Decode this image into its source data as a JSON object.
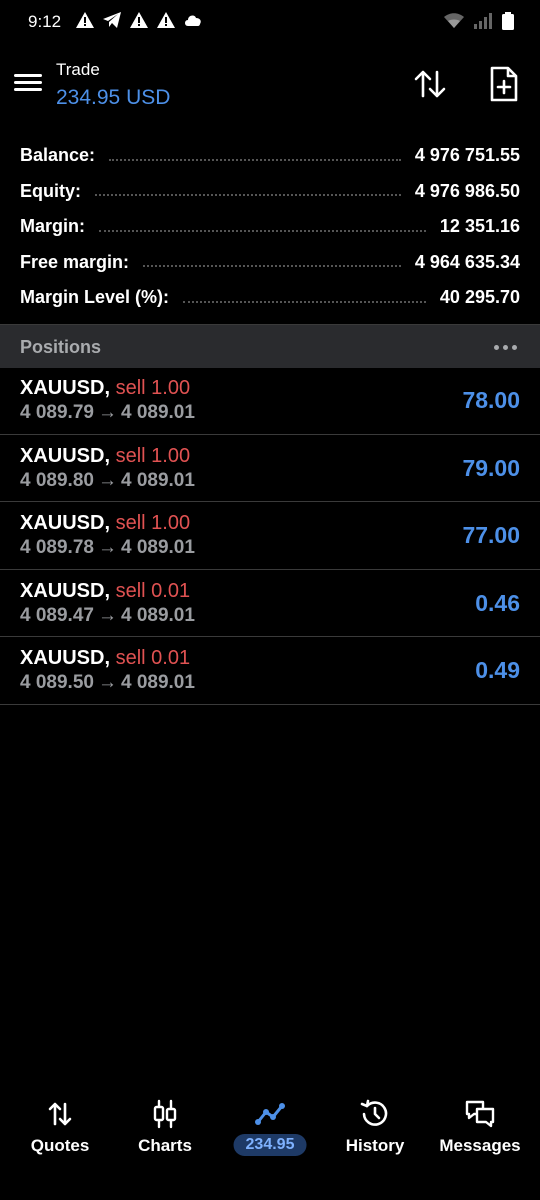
{
  "status_bar": {
    "time": "9:12"
  },
  "header": {
    "title": "Trade",
    "subtitle": "234.95 USD"
  },
  "summary": [
    {
      "label": "Balance:",
      "value": "4 976 751.55"
    },
    {
      "label": "Equity:",
      "value": "4 976 986.50"
    },
    {
      "label": "Margin:",
      "value": "12 351.16"
    },
    {
      "label": "Free margin:",
      "value": "4 964 635.34"
    },
    {
      "label": "Margin Level (%):",
      "value": "40 295.70"
    }
  ],
  "positions_header": {
    "label": "Positions"
  },
  "positions": [
    {
      "symbol": "XAUUSD,",
      "side": "sell 1.00",
      "open": "4 089.79",
      "arrow": "→",
      "current": "4 089.01",
      "profit": "78.00"
    },
    {
      "symbol": "XAUUSD,",
      "side": "sell 1.00",
      "open": "4 089.80",
      "arrow": "→",
      "current": "4 089.01",
      "profit": "79.00"
    },
    {
      "symbol": "XAUUSD,",
      "side": "sell 1.00",
      "open": "4 089.78",
      "arrow": "→",
      "current": "4 089.01",
      "profit": "77.00"
    },
    {
      "symbol": "XAUUSD,",
      "side": "sell 0.01",
      "open": "4 089.47",
      "arrow": "→",
      "current": "4 089.01",
      "profit": "0.46"
    },
    {
      "symbol": "XAUUSD,",
      "side": "sell 0.01",
      "open": "4 089.50",
      "arrow": "→",
      "current": "4 089.01",
      "profit": "0.49"
    }
  ],
  "bottom_nav": [
    {
      "label": "Quotes",
      "icon": "quotes-icon"
    },
    {
      "label": "Charts",
      "icon": "charts-icon"
    },
    {
      "label": "234.95",
      "icon": "trade-icon",
      "active": true
    },
    {
      "label": "History",
      "icon": "history-icon"
    },
    {
      "label": "Messages",
      "icon": "messages-icon"
    }
  ],
  "colors": {
    "accent_blue": "#4d90e8",
    "sell_red": "#e05252",
    "muted_gray": "#9a9ca0",
    "background": "#000000"
  }
}
